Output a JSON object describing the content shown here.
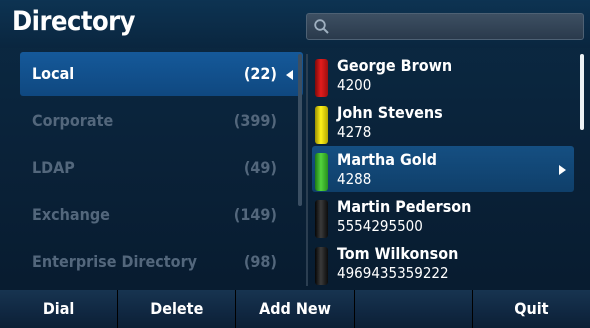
{
  "header": {
    "title": "Directory",
    "search_placeholder": ""
  },
  "directories": [
    {
      "label": "Local",
      "count": "(22)",
      "selected": true
    },
    {
      "label": "Corporate",
      "count": "(399)",
      "selected": false
    },
    {
      "label": "LDAP",
      "count": "(49)",
      "selected": false
    },
    {
      "label": "Exchange",
      "count": "(149)",
      "selected": false
    },
    {
      "label": "Enterprise Directory",
      "count": "(98)",
      "selected": false
    }
  ],
  "contacts": [
    {
      "name": "George Brown",
      "number": "4200",
      "presence": "red"
    },
    {
      "name": "John Stevens",
      "number": "4278",
      "presence": "yellow"
    },
    {
      "name": "Martha Gold",
      "number": "4288",
      "presence": "green"
    },
    {
      "name": "Martin Pederson",
      "number": "5554295500",
      "presence": "offline"
    },
    {
      "name": "Tom Wilkonson",
      "number": "4969435359222",
      "presence": "offline"
    }
  ],
  "softkeys": [
    "Dial",
    "Delete",
    "Add New",
    "",
    "Quit"
  ],
  "colors": {
    "accent": "#15599a",
    "background": "#0a2239",
    "present": "#52d33c",
    "busy": "#e31c1c",
    "away": "#fff21a"
  }
}
